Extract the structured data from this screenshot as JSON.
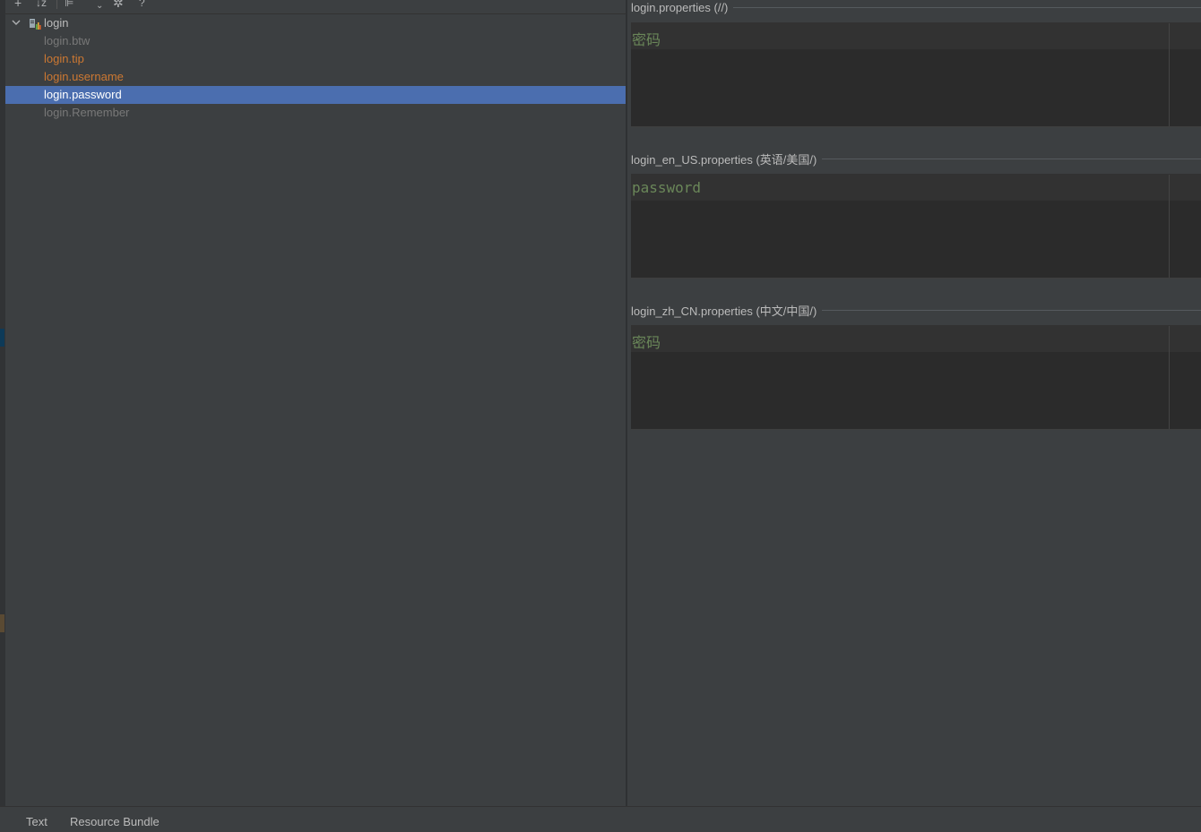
{
  "toolbar": {
    "icons": [
      "add-icon",
      "sort-alpha-icon",
      "group-by-prefix-icon",
      "expand-dropdown-icon",
      "settings-icon",
      "help-icon"
    ]
  },
  "tree": {
    "root": {
      "label": "login",
      "icon": "resource-bundle-icon",
      "expanded": true
    },
    "items": [
      {
        "label": "login.btw",
        "color": "#787878"
      },
      {
        "label": "login.tip",
        "color": "#cc7832"
      },
      {
        "label": "login.username",
        "color": "#cc7832"
      },
      {
        "label": "login.password",
        "color": "#ffffff",
        "selected": true
      },
      {
        "label": "login.Remember",
        "color": "#787878"
      }
    ]
  },
  "editors": [
    {
      "title": "login.properties (//)",
      "value": "密码"
    },
    {
      "title": "login_en_US.properties (英语/美国/)",
      "value": "password"
    },
    {
      "title": "login_zh_CN.properties (中文/中国/)",
      "value": "密码"
    }
  ],
  "bottom_tabs": [
    "Text",
    "Resource Bundle"
  ],
  "colors": {
    "selection": "#4b6eaf",
    "value_string": "#6a8759",
    "key_modified": "#cc7832",
    "key_unused": "#787878"
  }
}
